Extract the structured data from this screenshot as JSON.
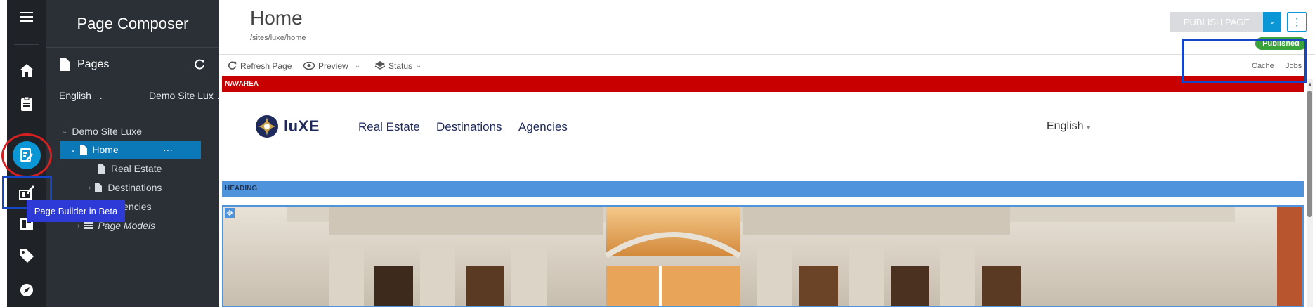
{
  "sidebar": {
    "title": "Page Composer",
    "pages_label": "Pages",
    "language": "English",
    "site_selector": "Demo Site Lux",
    "tree": {
      "root": "Demo Site Luxe",
      "selected": "Home",
      "real_estate": "Real Estate",
      "destinations": "Destinations",
      "agencies": "Agencies",
      "page_models": "Page Models"
    }
  },
  "rail": {
    "tooltip": "Page Builder in Beta"
  },
  "header": {
    "title": "Home",
    "path": "/sites/luxe/home",
    "publish_button": "PUBLISH PAGE",
    "status_badge": "Published"
  },
  "toolbar": {
    "refresh": "Refresh Page",
    "preview": "Preview",
    "status": "Status",
    "cache": "Cache",
    "jobs": "Jobs"
  },
  "preview": {
    "navarea_label": "NAVAREA",
    "heading_label": "HEADING",
    "logo_text": "luXE",
    "nav": [
      "Real Estate",
      "Destinations",
      "Agencies"
    ],
    "language": "English"
  },
  "colors": {
    "rail_bg": "#1f2227",
    "sidebar_bg": "#2b3036",
    "selected_item": "#0b78b8",
    "accent": "#0b97d6",
    "published": "#3aa43a",
    "navarea": "#c90000",
    "heading": "#4f93dd",
    "annotation_red": "#d42020",
    "annotation_blue": "#1546c8",
    "brand_navy": "#1e2a5c"
  },
  "icons": [
    "hamburger-icon",
    "home-icon",
    "clipboard-icon",
    "edit-page-icon",
    "page-builder-icon",
    "layout-icon",
    "tag-icon",
    "compass-icon",
    "file-icon",
    "refresh-icon",
    "eye-icon",
    "layers-icon",
    "kebab-icon",
    "move-icon"
  ]
}
